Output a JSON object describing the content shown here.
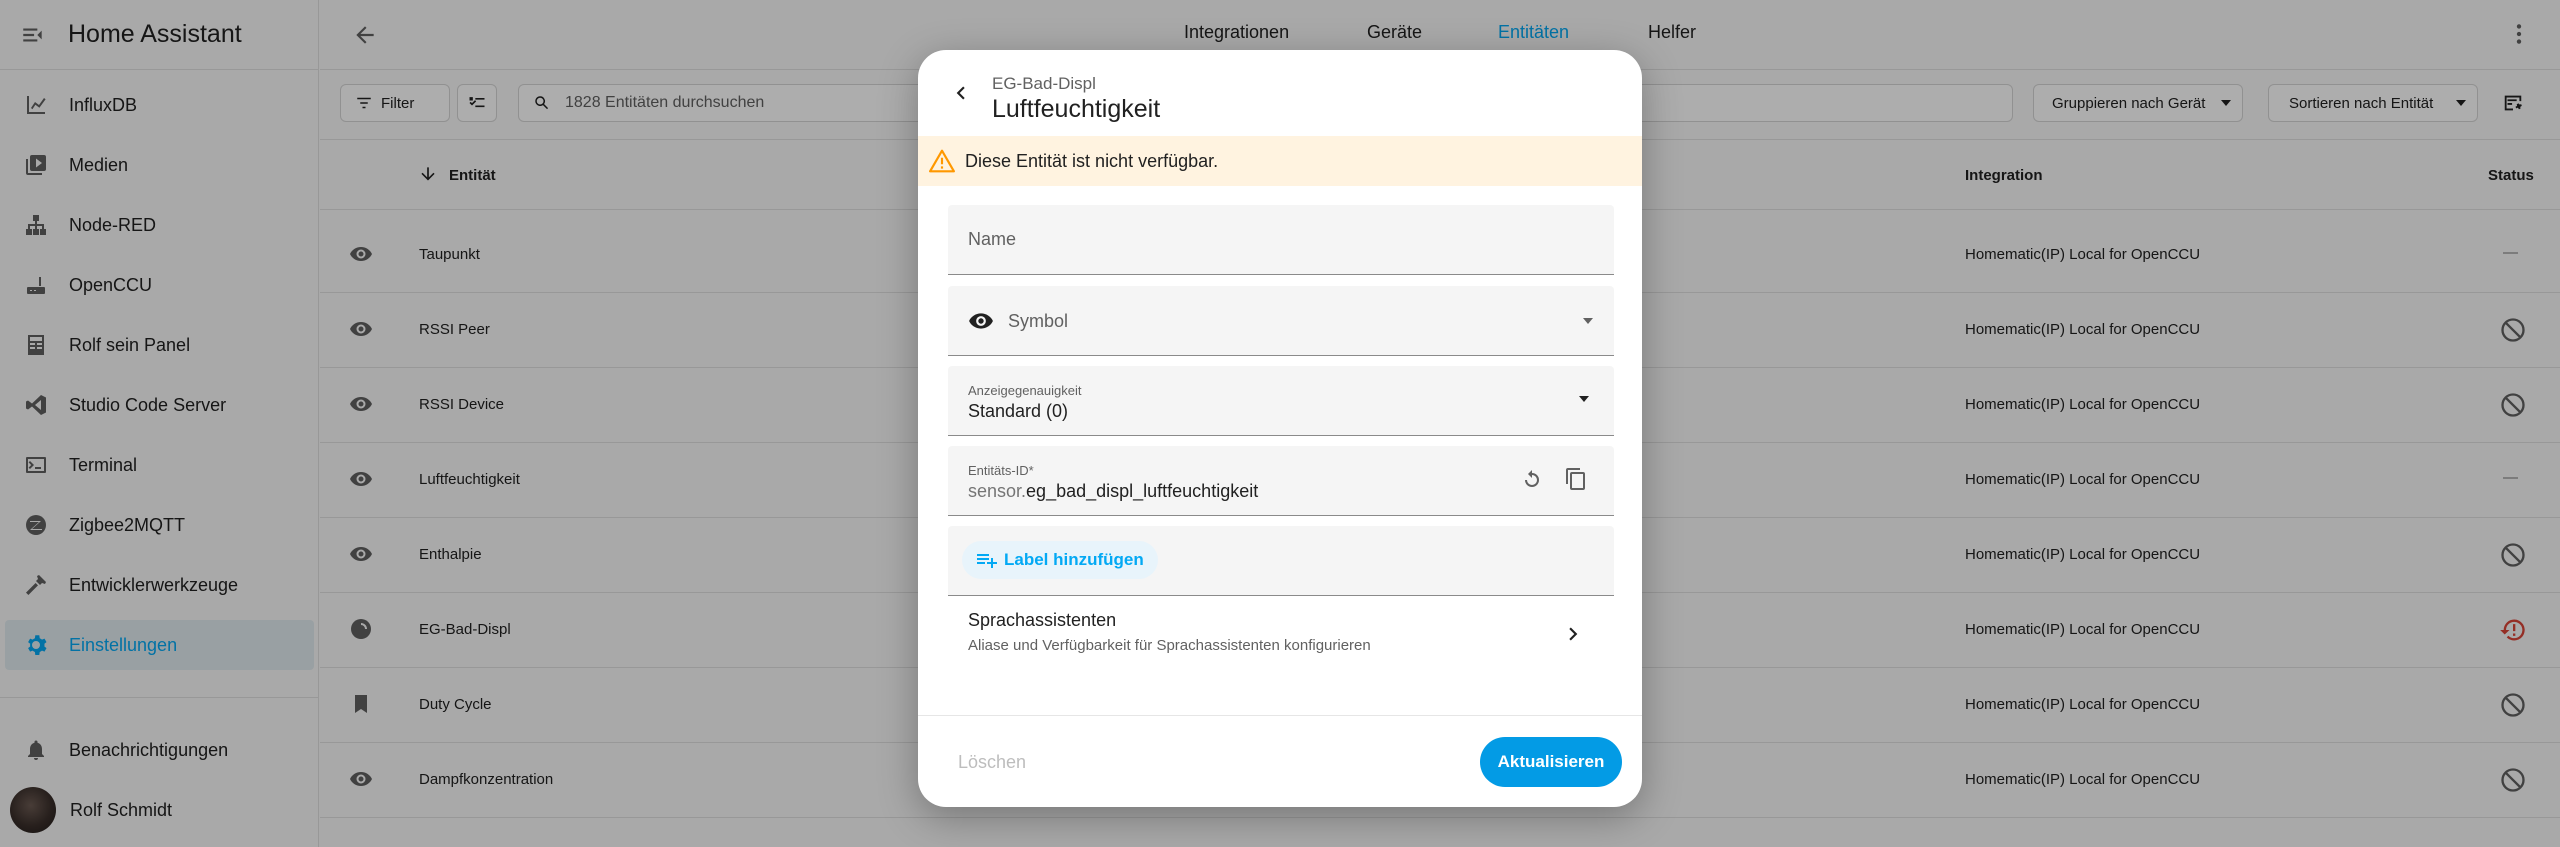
{
  "app": {
    "title": "Home Assistant"
  },
  "sidebar": {
    "items": [
      {
        "label": "InfluxDB",
        "icon": "chart-icon"
      },
      {
        "label": "Medien",
        "icon": "media-icon"
      },
      {
        "label": "Node-RED",
        "icon": "sitemap-icon"
      },
      {
        "label": "OpenCCU",
        "icon": "router-icon"
      },
      {
        "label": "Rolf sein Panel",
        "icon": "panel-icon"
      },
      {
        "label": "Studio Code Server",
        "icon": "vscode-icon"
      },
      {
        "label": "Terminal",
        "icon": "terminal-icon"
      },
      {
        "label": "Zigbee2MQTT",
        "icon": "zigbee-icon"
      },
      {
        "label": "Entwicklerwerkzeuge",
        "icon": "hammer-icon"
      },
      {
        "label": "Einstellungen",
        "icon": "gear-icon",
        "active": true
      }
    ],
    "notifications": "Benachrichtigungen",
    "user": "Rolf Schmidt"
  },
  "topbar": {
    "tabs": [
      "Integrationen",
      "Geräte",
      "Entitäten",
      "Helfer"
    ],
    "active_tab": "Entitäten"
  },
  "filterbar": {
    "filter_label": "Filter",
    "search_placeholder": "1828 Entitäten durchsuchen",
    "group_by": "Gruppieren nach Gerät",
    "sort_by": "Sortieren nach Entität"
  },
  "table": {
    "col_entity": "Entität",
    "col_integration": "Integration",
    "col_status": "Status",
    "rows": [
      {
        "name": "Taupunkt",
        "integration": "Homematic(IP) Local for OpenCCU",
        "status": "—"
      },
      {
        "name": "RSSI Peer",
        "integration": "Homematic(IP) Local for OpenCCU",
        "status": "disabled"
      },
      {
        "name": "RSSI Device",
        "integration": "Homematic(IP) Local for OpenCCU",
        "status": "disabled"
      },
      {
        "name": "Luftfeuchtigkeit",
        "integration": "Homematic(IP) Local for OpenCCU",
        "status": "—"
      },
      {
        "name": "Enthalpie",
        "integration": "Homematic(IP) Local for OpenCCU",
        "status": "disabled"
      },
      {
        "name": "EG-Bad-Displ",
        "integration": "Homematic(IP) Local for OpenCCU",
        "status": "restore"
      },
      {
        "name": "Duty Cycle",
        "integration": "Homematic(IP) Local for OpenCCU",
        "status": "disabled"
      },
      {
        "name": "Dampfkonzentration",
        "integration": "Homematic(IP) Local for OpenCCU",
        "status": "disabled"
      }
    ]
  },
  "dialog": {
    "subtitle": "EG-Bad-Displ",
    "title": "Luftfeuchtigkeit",
    "warning": "Diese Entität ist nicht verfügbar.",
    "name_label": "Name",
    "symbol_label": "Symbol",
    "precision_label": "Anzeigegenauigkeit",
    "precision_value": "Standard (0)",
    "entity_id_label": "Entitäts-ID*",
    "entity_id_prefix": "sensor.",
    "entity_id_value": "eg_bad_displ_luftfeuchtigkeit",
    "add_label": "Label hinzufügen",
    "voice_title": "Sprachassistenten",
    "voice_desc": "Aliase und Verfügbarkeit für Sprachassistenten konfigurieren",
    "delete_button": "Löschen",
    "update_button": "Aktualisieren"
  },
  "colors": {
    "accent": "#03a9f4",
    "warning": "#ff9800",
    "error": "#db4437"
  }
}
